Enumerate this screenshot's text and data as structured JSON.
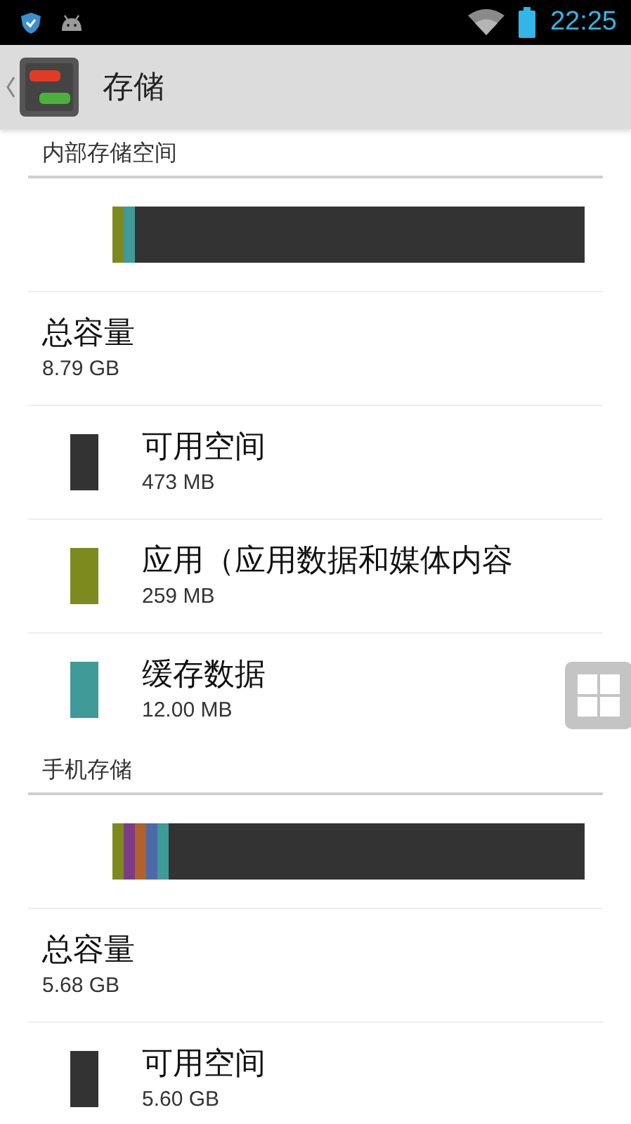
{
  "status_bar": {
    "time": "22:25"
  },
  "app_bar": {
    "title": "存储"
  },
  "sections": [
    {
      "title": "内部存储空间",
      "bar": {
        "segments": [
          {
            "color": "#7d8a1e"
          },
          {
            "color": "#3f9a98"
          },
          {
            "color": "#333333"
          }
        ]
      },
      "total": {
        "label": "总容量",
        "value": "8.79 GB"
      },
      "items": [
        {
          "label": "可用空间",
          "value": "473 MB",
          "color": "#333333"
        },
        {
          "label": "应用（应用数据和媒体内容",
          "value": "259 MB",
          "color": "#7d8a1e"
        },
        {
          "label": "缓存数据",
          "value": "12.00 MB",
          "color": "#3f9a98"
        }
      ]
    },
    {
      "title": "手机存储",
      "bar": {
        "segments": [
          {
            "color": "#7d8a1e"
          },
          {
            "color": "#7f3c86"
          },
          {
            "color": "#b0622a"
          },
          {
            "color": "#4d6aa8"
          },
          {
            "color": "#3f9a98"
          },
          {
            "color": "#333333"
          }
        ]
      },
      "total": {
        "label": "总容量",
        "value": "5.68 GB"
      },
      "items": [
        {
          "label": "可用空间",
          "value": "5.60 GB",
          "color": "#333333"
        }
      ]
    }
  ]
}
